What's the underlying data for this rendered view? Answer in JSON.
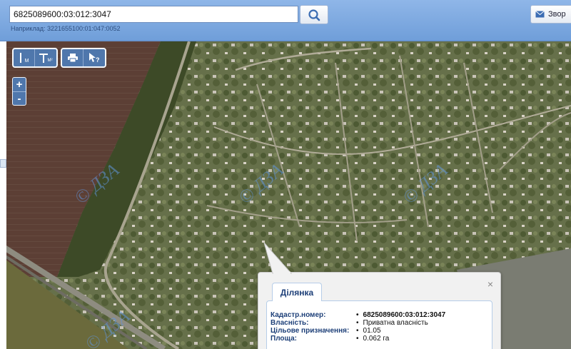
{
  "search": {
    "value": "6825089600:03:012:3047",
    "hint": "Наприклад: 3221655100:01:047:0052"
  },
  "header": {
    "feedback_label": "Звор"
  },
  "map": {
    "watermark": "© ДЗА",
    "toolbar": {
      "measure_line_label": "M",
      "measure_area_label": "M²"
    },
    "zoom": {
      "in_label": "+",
      "out_label": "-"
    }
  },
  "popup": {
    "tab_label": "Ділянка",
    "close_label": "×",
    "properties": [
      {
        "key": "Кадастр.номер:",
        "value": "6825089600:03:012:3047"
      },
      {
        "key": "Власність:",
        "value": "Приватна власність"
      },
      {
        "key": "Цільове призначення:",
        "value": "01.05"
      },
      {
        "key": "Площа:",
        "value": "0.062 га"
      }
    ]
  },
  "colors": {
    "header": "#7ea8df",
    "accent": "#4f77ac",
    "popup_key": "#1d3f78"
  }
}
